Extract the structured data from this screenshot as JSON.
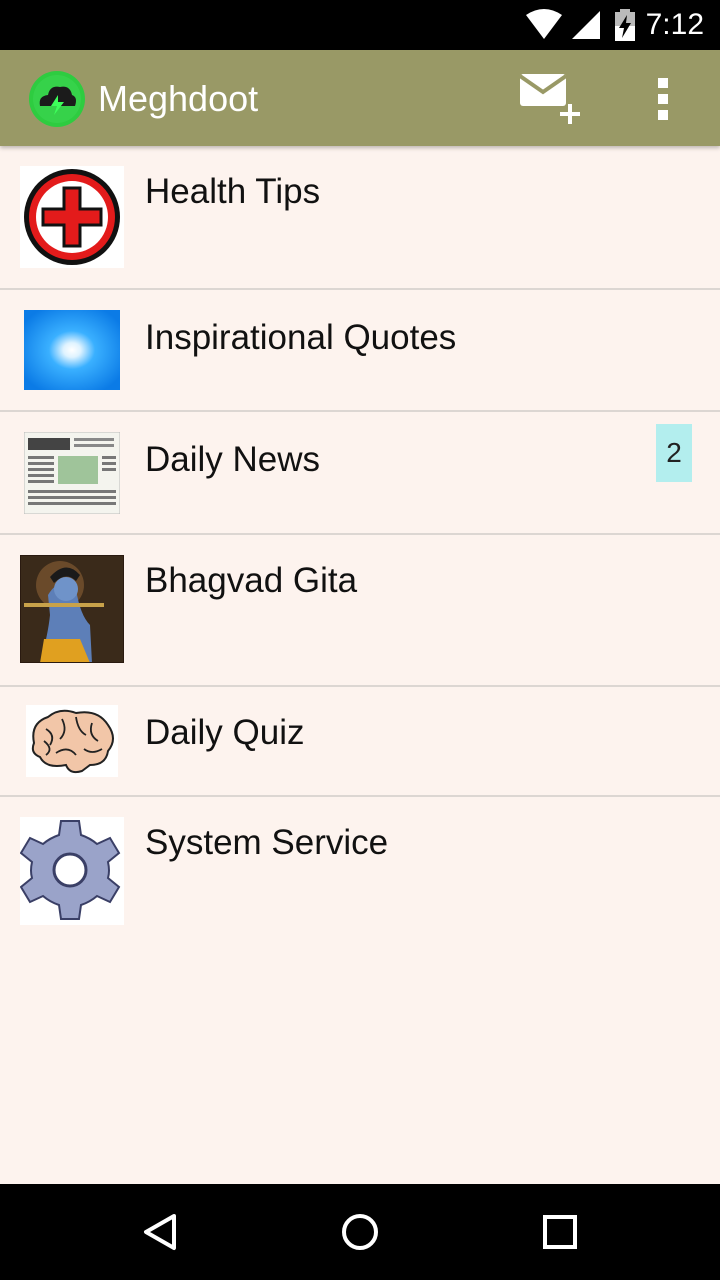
{
  "status_bar": {
    "time": "7:12",
    "icons": [
      "wifi-icon",
      "signal-icon",
      "battery-charging-icon"
    ]
  },
  "app_bar": {
    "title": "Meghdoot",
    "logo_icon": "cloud-lightning-icon",
    "actions": [
      "compose-message-icon",
      "overflow-menu-icon"
    ],
    "background_color": "#999966"
  },
  "list": {
    "items": [
      {
        "label": "Health Tips",
        "icon": "red-cross-icon"
      },
      {
        "label": "Inspirational Quotes",
        "icon": "sunburst-icon"
      },
      {
        "label": "Daily News",
        "icon": "newspaper-icon",
        "badge": "2"
      },
      {
        "label": "Bhagvad Gita",
        "icon": "krishna-image"
      },
      {
        "label": "Daily Quiz",
        "icon": "brain-icon"
      },
      {
        "label": "System Service",
        "icon": "gear-icon"
      }
    ]
  },
  "nav_bar": {
    "buttons": [
      "back-icon",
      "home-icon",
      "recents-icon"
    ]
  }
}
